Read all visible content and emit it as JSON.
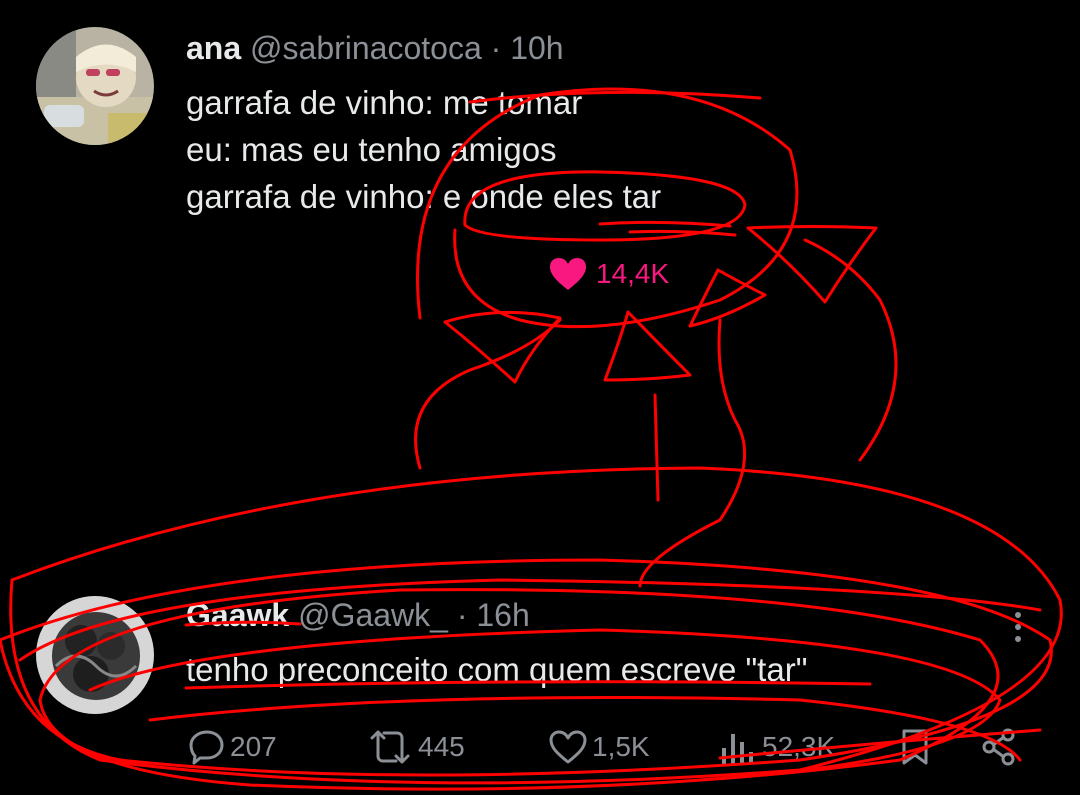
{
  "quoted_tweet": {
    "author_name": "ana",
    "author_handle": "@sabrinacotoca",
    "separator": "·",
    "time": "10h",
    "lines": [
      "garrafa de vinho: me tomar",
      "eu: mas eu tenho amigos",
      "garrafa de vinho: e onde eles tar"
    ],
    "like_icon": "heart-filled-icon",
    "like_count": "14,4K"
  },
  "reply_tweet": {
    "author_name": "Gaawk",
    "author_handle": "@Gaawk_",
    "separator": "·",
    "time": "16h",
    "text": "tenho preconceito com quem escreve \"tar\"",
    "actions": {
      "replies": "207",
      "reposts": "445",
      "likes": "1,5K",
      "views": "52,3K"
    },
    "more_icon": "more-vertical-icon"
  },
  "colors": {
    "background": "#000000",
    "text": "#e7e9ea",
    "secondary_text": "#8b9096",
    "like_pink": "#f91880",
    "annotation_red": "#ff0000"
  }
}
